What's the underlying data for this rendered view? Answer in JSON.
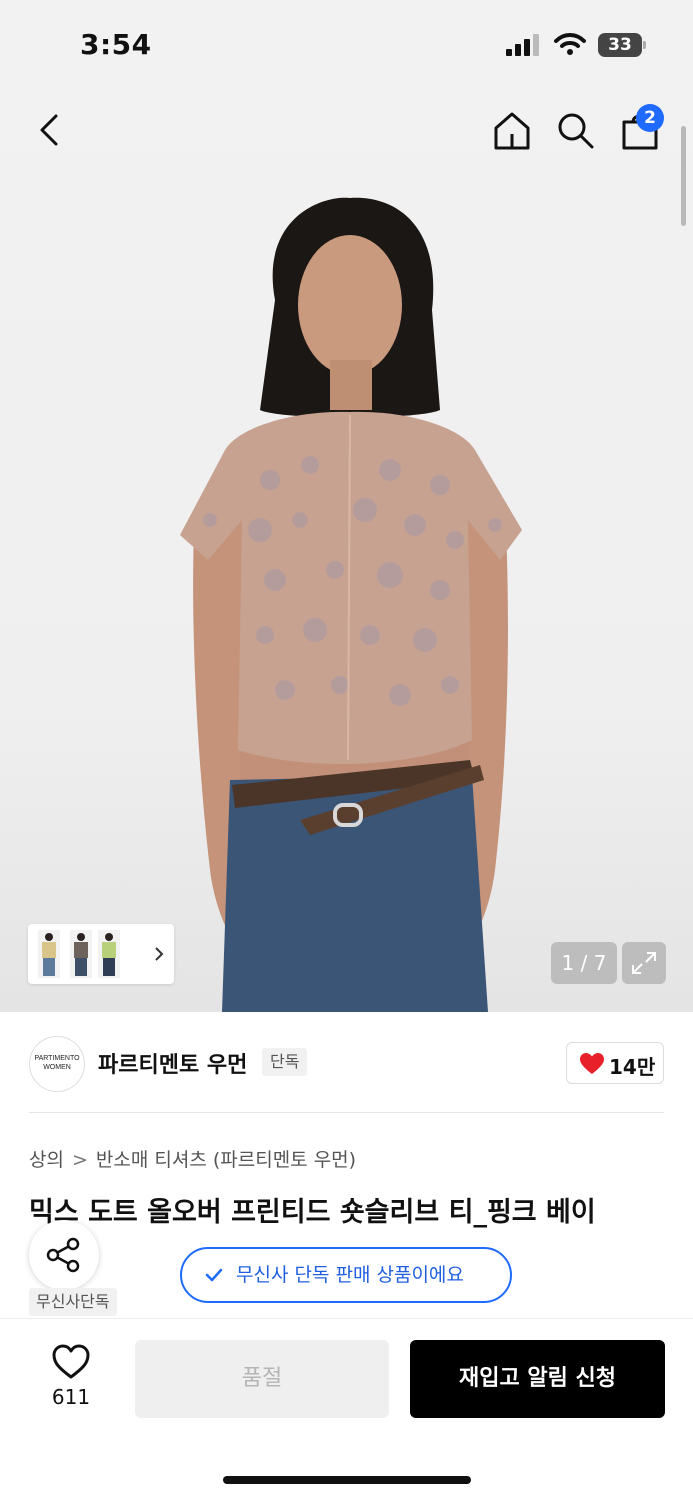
{
  "status_bar": {
    "time": "3:54",
    "battery": "33"
  },
  "nav": {
    "cart_badge": "2",
    "icons": [
      "back-icon",
      "home-icon",
      "search-icon",
      "cart-icon"
    ]
  },
  "gallery": {
    "page_counter": "1 / 7",
    "current_page": 1,
    "total_pages": 7
  },
  "brand": {
    "logo_line1": "PARTIMENTO",
    "logo_line2": "WOMEN",
    "name": "파르티멘토 우먼",
    "tag": "단독",
    "likes": "14만"
  },
  "breadcrumb": {
    "category": "상의",
    "subcategory": "반소매 티셔츠 (파르티멘토 우먼)"
  },
  "product": {
    "title": "믹스 도트 올오버 프린티드 숏슬리브 티_핑크 베이"
  },
  "exclusive_notice": "무신사 단독 판매 상품이에요",
  "musinsa_tag": "무신사단독",
  "action_bar": {
    "wish_count": "611",
    "soldout_label": "품절",
    "restock_label": "재입고 알림 신청"
  },
  "colors": {
    "accent_blue": "#1f6bff",
    "heart_red": "#e8202a",
    "primary_button": "#000000"
  }
}
